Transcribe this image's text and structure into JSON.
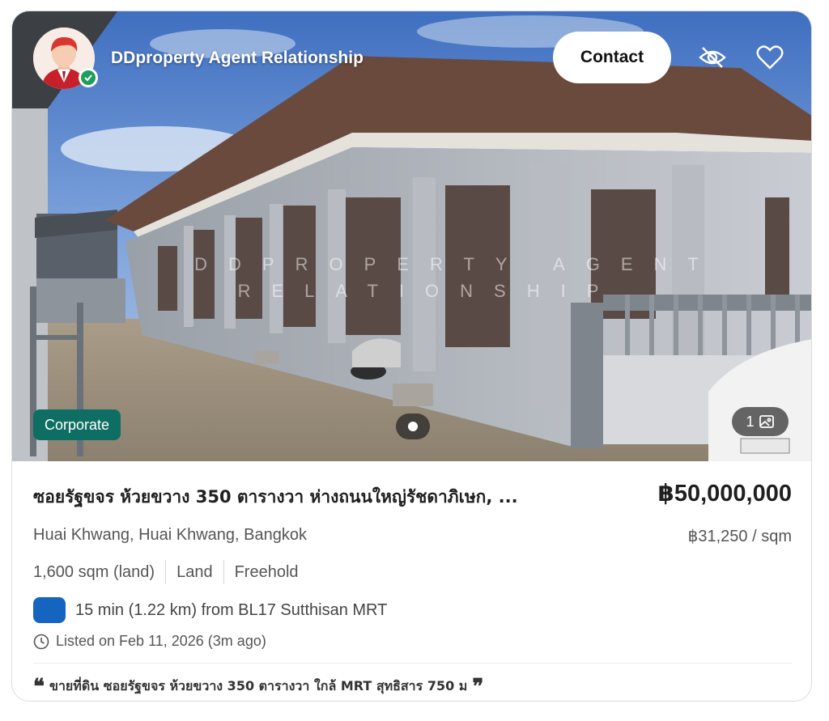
{
  "agent": {
    "name": "DDproperty Agent Relationship",
    "avatar_icon": "agent-avatar",
    "verified_icon": "check-badge-icon"
  },
  "actions": {
    "contact_label": "Contact",
    "hide_icon": "eye-off-icon",
    "favorite_icon": "heart-icon"
  },
  "photo": {
    "watermark_line1": "DDPROPERTY AGENT",
    "watermark_line2": "RELATIONSHIP",
    "badge": "Corporate",
    "photo_count": "1",
    "photo_icon": "image-icon"
  },
  "listing": {
    "title": "ซอยรัฐขจร ห้วยขวาง 350 ตารางวา ห่างถนนใหญ่รัชดาภิเษก, ...",
    "price": "฿50,000,000",
    "location": "Huai Khwang, Huai Khwang, Bangkok",
    "price_per_sqm": "฿31,250 / sqm",
    "specs": [
      "1,600 sqm (land)",
      "Land",
      "Freehold"
    ],
    "transit": "15 min (1.22 km) from BL17 Sutthisan MRT",
    "listed": "Listed on Feb 11, 2026 (3m ago)",
    "quote_open": "❝",
    "quote_text": "ขายที่ดิน ซอยรัฐขจร ห้วยขวาง 350 ตารางวา ใกล้ MRT สุทธิสาร 750 ม",
    "quote_close": "❞"
  },
  "colors": {
    "badge_bg": "#0f6e63",
    "transit_icon": "#1565c0",
    "verified": "#1e9e5a"
  }
}
